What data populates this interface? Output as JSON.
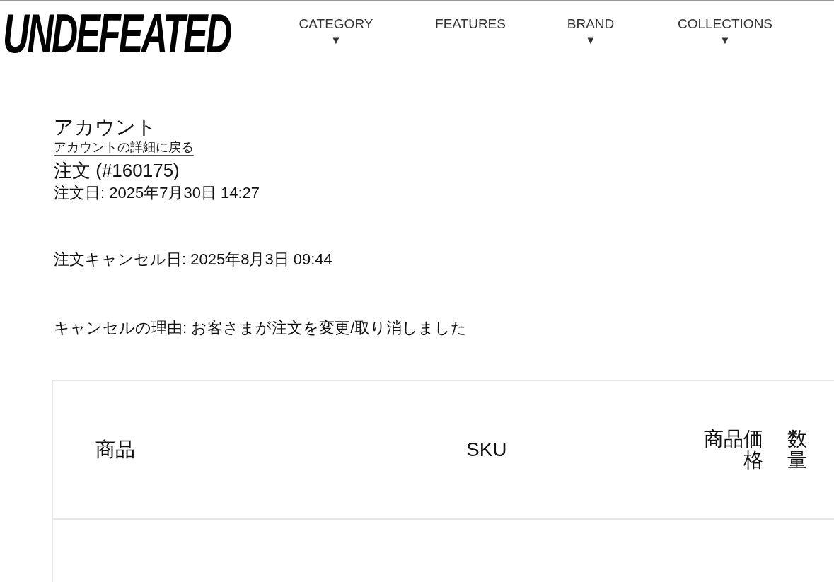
{
  "header": {
    "logo": "UNDEFEATED",
    "nav": [
      {
        "label": "CATEGORY",
        "caret": "▼"
      },
      {
        "label": "FEATURES"
      },
      {
        "label": "BRAND",
        "caret": "▼"
      },
      {
        "label": "COLLECTIONS",
        "caret": "▼"
      }
    ]
  },
  "account": {
    "title": "アカウント",
    "back_link": "アカウントの詳細に戻る",
    "order_title": "注文 (#160175)",
    "order_date": "注文日: 2025年7月30日 14:27",
    "cancel_date": "注文キャンセル日: 2025年8月3日 09:44",
    "cancel_reason": "キャンセルの理由: お客さまが注文を変更/取り消しました"
  },
  "table": {
    "columns": [
      "商品",
      "SKU",
      "商品価格",
      "数量"
    ]
  }
}
